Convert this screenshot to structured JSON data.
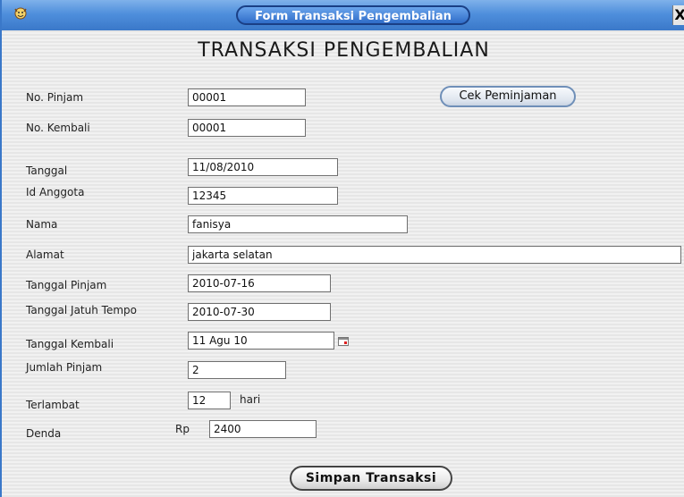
{
  "window": {
    "title": "Form Transaksi Pengembalian",
    "close_label": "X"
  },
  "heading": "TRANSAKSI PENGEMBALIAN",
  "fields": {
    "no_pinjam": {
      "label": "No. Pinjam",
      "value": "00001"
    },
    "no_kembali": {
      "label": "No. Kembali",
      "value": "00001"
    },
    "tanggal": {
      "label": "Tanggal",
      "value": "11/08/2010"
    },
    "id_anggota": {
      "label": "Id Anggota",
      "value": "12345"
    },
    "nama": {
      "label": "Nama",
      "value": "fanisya"
    },
    "alamat": {
      "label": "Alamat",
      "value": "jakarta selatan"
    },
    "tanggal_pinjam": {
      "label": "Tanggal Pinjam",
      "value": "2010-07-16"
    },
    "tanggal_jatuh_tempo": {
      "label": "Tanggal Jatuh Tempo",
      "value": "2010-07-30"
    },
    "tanggal_kembali": {
      "label": "Tanggal Kembali",
      "value": "11 Agu 10"
    },
    "jumlah_pinjam": {
      "label": "Jumlah Pinjam",
      "value": "2"
    },
    "terlambat": {
      "label": "Terlambat",
      "value": "12",
      "unit": "hari"
    },
    "denda": {
      "label": "Denda",
      "prefix": "Rp",
      "value": "2400"
    }
  },
  "buttons": {
    "cek_peminjaman": "Cek Peminjaman",
    "simpan_transaksi": "Simpan Transaksi"
  },
  "colors": {
    "titlebar": "#3a78c9",
    "background": "#eeeeee"
  },
  "icons": {
    "app": "app-icon",
    "calendar": "calendar-icon",
    "close": "close-icon"
  }
}
